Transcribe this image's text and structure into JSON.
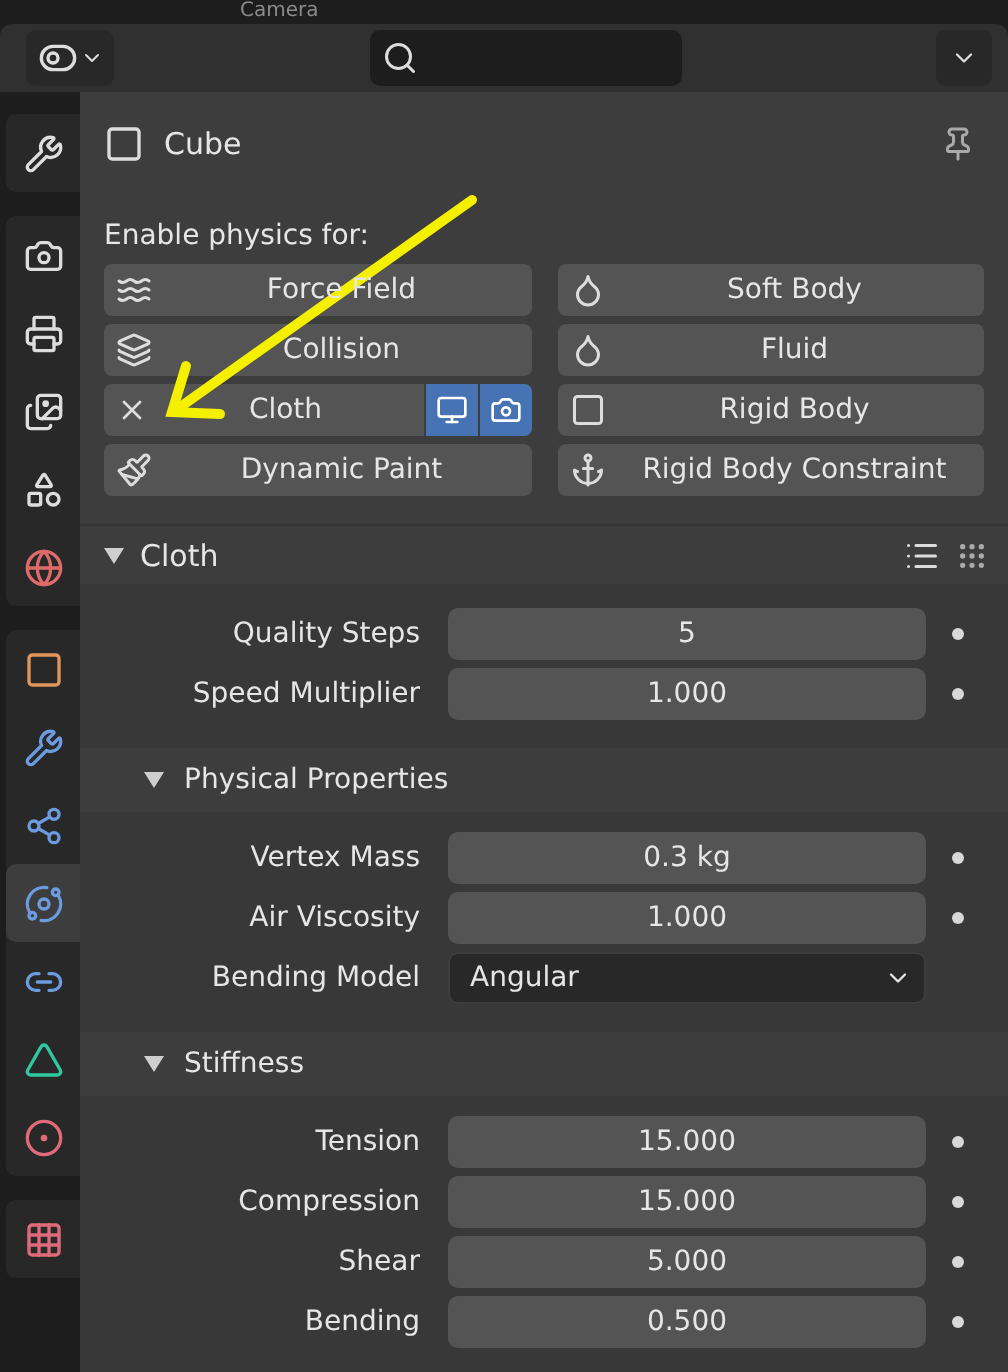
{
  "outliner_strip": {
    "text": "Camera"
  },
  "tab_groups": [
    {
      "tabs": [
        {
          "selected": false
        }
      ]
    },
    {
      "tabs": [
        {
          "selected": false
        },
        {
          "selected": false
        },
        {
          "selected": false
        },
        {
          "selected": false
        },
        {
          "selected": false
        }
      ]
    },
    {
      "tabs": [
        {
          "selected": false
        },
        {
          "selected": false
        },
        {
          "selected": false
        },
        {
          "selected": true
        },
        {
          "selected": false
        },
        {
          "selected": false
        },
        {
          "selected": false
        }
      ]
    },
    {
      "tabs": [
        {
          "selected": false
        }
      ]
    }
  ],
  "object": {
    "name": "Cube"
  },
  "physics": {
    "heading": "Enable physics for:",
    "buttons": [
      {
        "label": "Force Field",
        "enabled": false
      },
      {
        "label": "Soft Body",
        "enabled": false
      },
      {
        "label": "Collision",
        "enabled": false
      },
      {
        "label": "Fluid",
        "enabled": false
      },
      {
        "label": "Cloth",
        "enabled": true,
        "viewport": true,
        "render": true
      },
      {
        "label": "Rigid Body",
        "enabled": false
      },
      {
        "label": "Dynamic Paint",
        "enabled": false
      },
      {
        "label": "Rigid Body Constraint",
        "enabled": false
      }
    ]
  },
  "panel": {
    "title": "Cloth",
    "expanded": true,
    "rows": [
      {
        "label": "Quality Steps",
        "value": "5",
        "kind": "number"
      },
      {
        "label": "Speed Multiplier",
        "value": "1.000",
        "kind": "number"
      }
    ],
    "subpanels": [
      {
        "title": "Physical Properties",
        "expanded": true,
        "rows": [
          {
            "label": "Vertex Mass",
            "value": "0.3 kg",
            "kind": "number"
          },
          {
            "label": "Air Viscosity",
            "value": "1.000",
            "kind": "number"
          },
          {
            "label": "Bending Model",
            "value": "Angular",
            "kind": "dropdown"
          }
        ]
      },
      {
        "title": "Stiffness",
        "expanded": true,
        "rows": [
          {
            "label": "Tension",
            "value": "15.000",
            "kind": "number"
          },
          {
            "label": "Compression",
            "value": "15.000",
            "kind": "number"
          },
          {
            "label": "Shear",
            "value": "5.000",
            "kind": "number"
          },
          {
            "label": "Bending",
            "value": "0.500",
            "kind": "number"
          }
        ]
      }
    ]
  }
}
